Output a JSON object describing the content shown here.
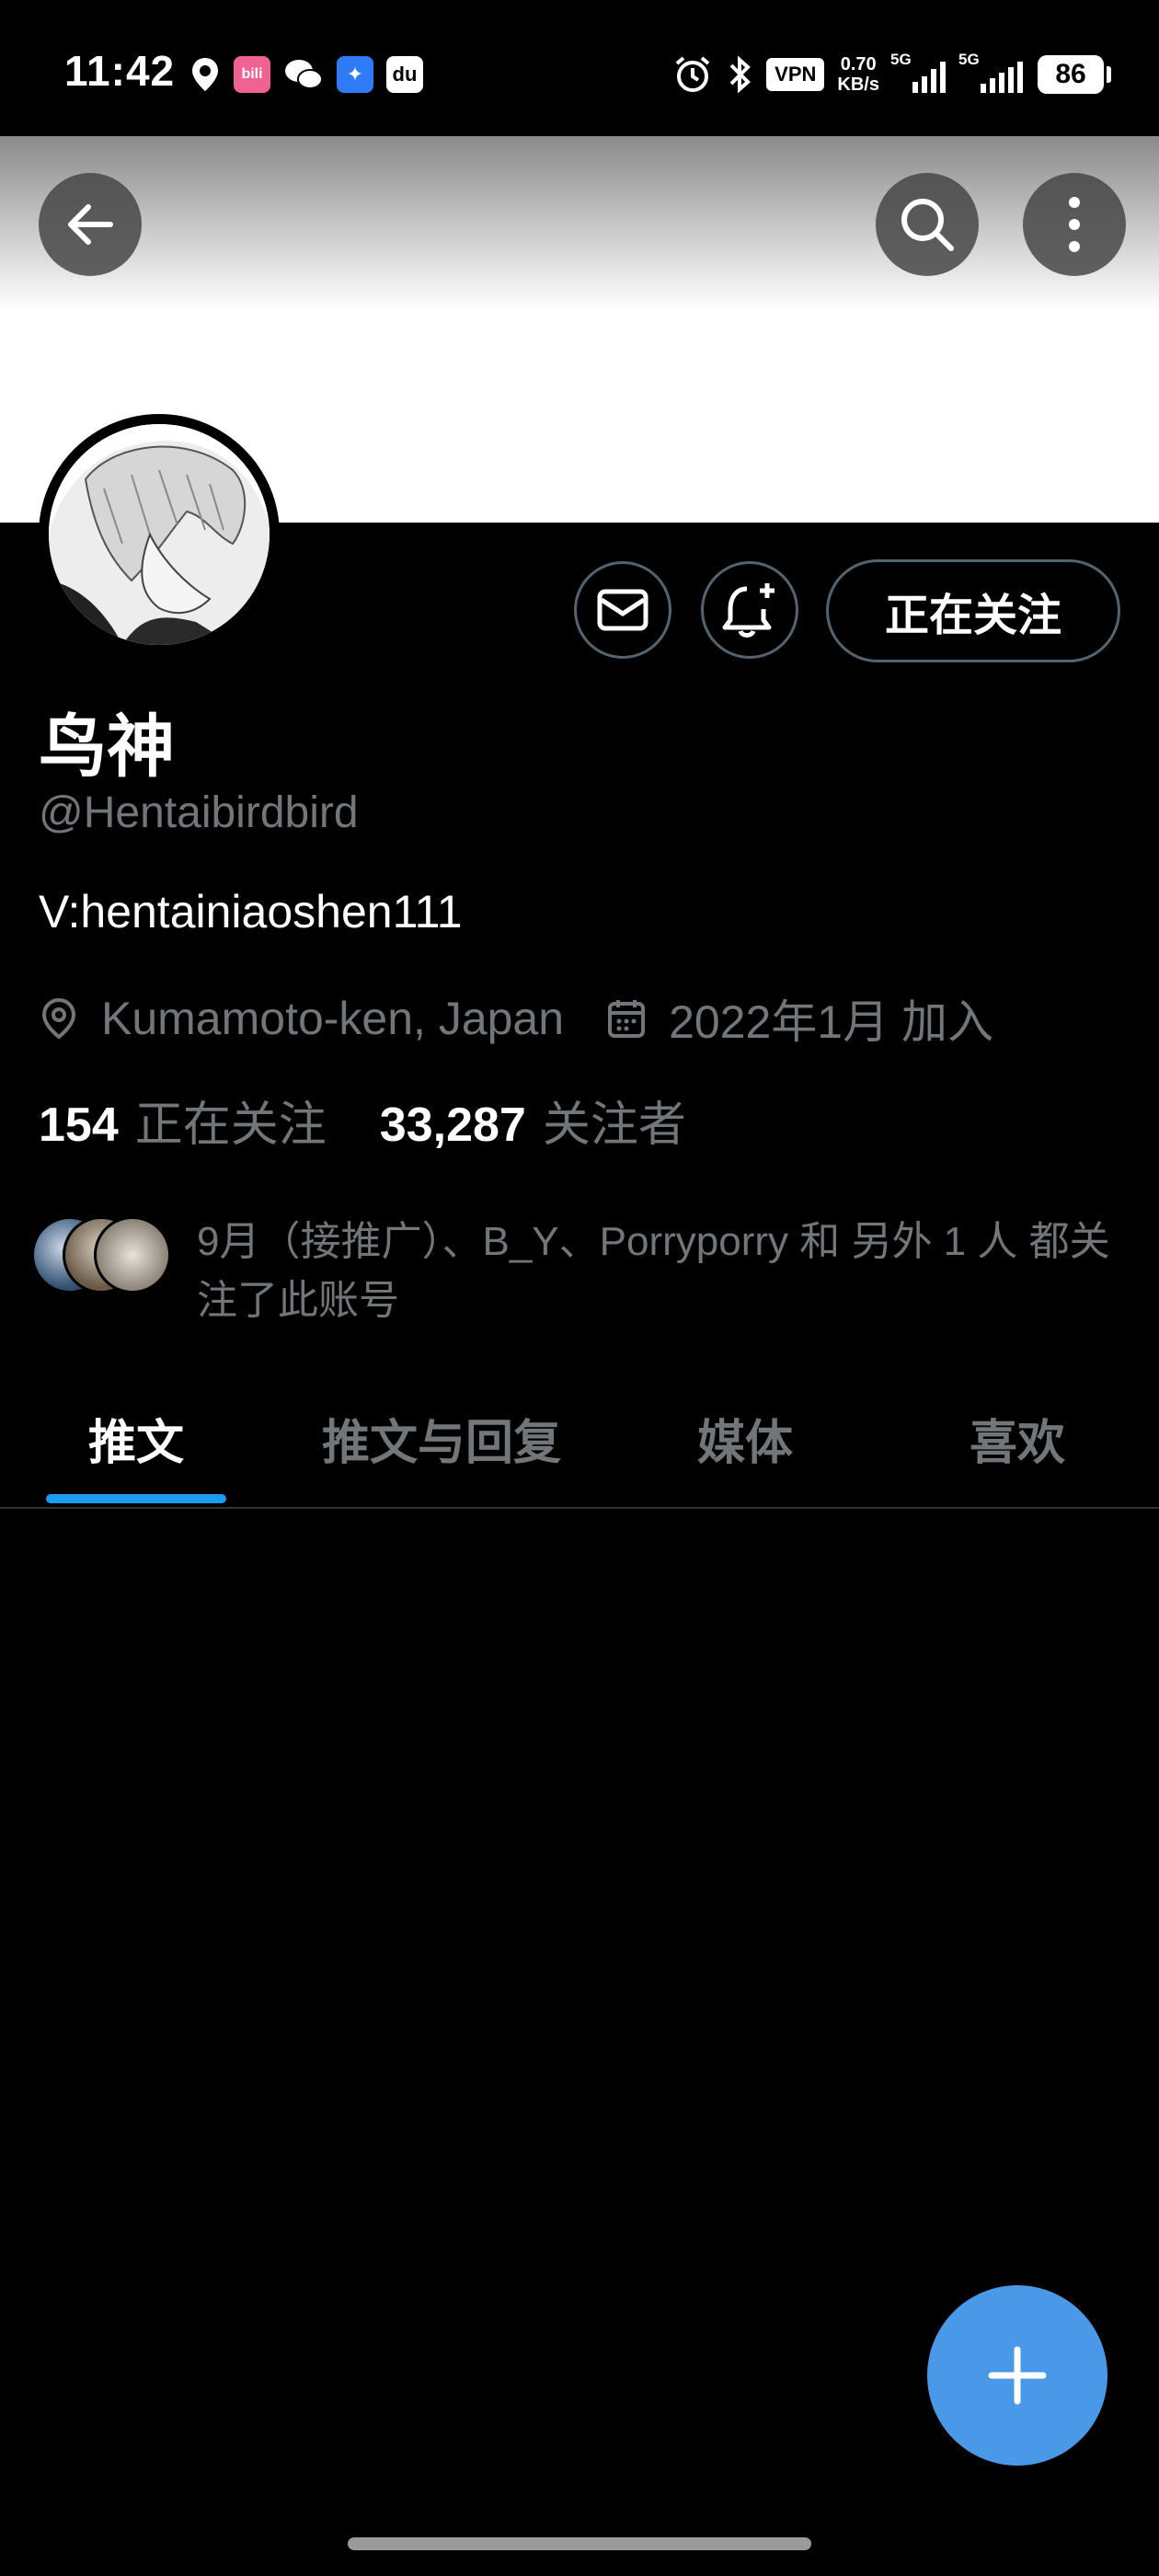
{
  "status_bar": {
    "time": "11:42",
    "vpn": "VPN",
    "speed_value": "0.70",
    "speed_unit": "KB/s",
    "signal1": "5G",
    "signal2": "5G",
    "battery": "86"
  },
  "profile": {
    "display_name": "鸟神",
    "handle": "@Hentaibirdbird",
    "bio": "V:hentainiaoshen111",
    "location": "Kumamoto-ken, Japan",
    "joined": "2022年1月 加入",
    "following_count": "154",
    "following_label": "正在关注",
    "followers_count": "33,287",
    "followers_label": "关注者",
    "follow_button": "正在关注",
    "known_followers_text": "9月（接推广）、B_Y、Porryporry 和 另外 1 人 都关注了此账号"
  },
  "tabs": [
    {
      "label": "推文",
      "active": true
    },
    {
      "label": "推文与回复",
      "active": false
    },
    {
      "label": "媒体",
      "active": false
    },
    {
      "label": "喜欢",
      "active": false
    }
  ],
  "colors": {
    "accent": "#1d9bf0",
    "fab": "#4a99e9",
    "secondary_text": "#71767b"
  },
  "icons": [
    "back-arrow-icon",
    "search-icon",
    "more-vertical-icon",
    "mail-icon",
    "bell-plus-icon",
    "location-pin-icon",
    "calendar-icon",
    "plus-icon"
  ]
}
